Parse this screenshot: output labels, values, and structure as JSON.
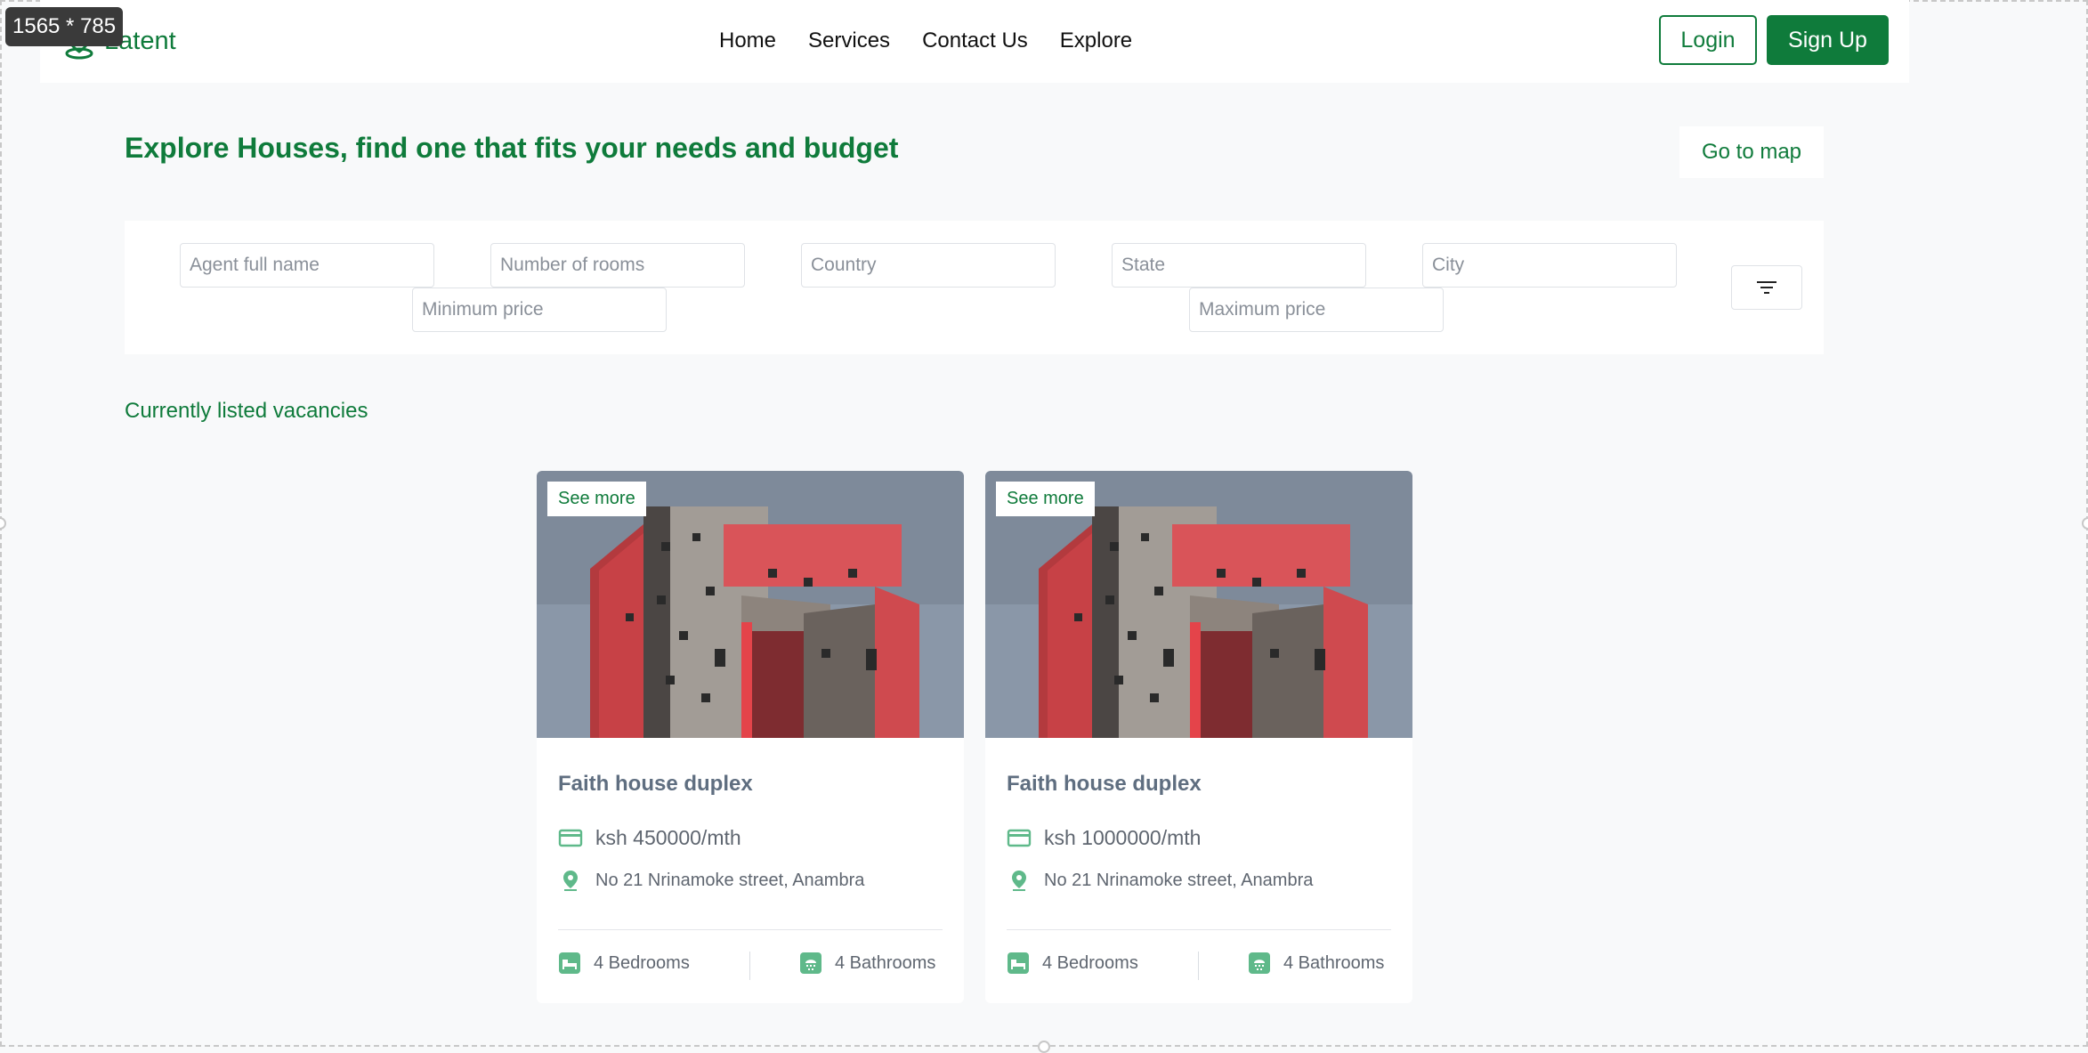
{
  "canvas_badge": "1565 * 785",
  "brand": {
    "name": "Latent",
    "logo_icon": "location-pin-logo-icon"
  },
  "nav": {
    "links": [
      "Home",
      "Services",
      "Contact Us",
      "Explore"
    ],
    "login_label": "Login",
    "signup_label": "Sign Up"
  },
  "heading": "Explore Houses, find one that fits your needs and budget",
  "map_button": "Go to map",
  "filters": {
    "agent": "Agent full name",
    "rooms": "Number of rooms",
    "country": "Country",
    "state": "State",
    "city": "City",
    "min_price": "Minimum price",
    "max_price": "Maximum price",
    "filter_icon": "filter-lines-icon"
  },
  "section_label": "Currently listed vacancies",
  "listings": [
    {
      "see_more": "See more",
      "title": "Faith house duplex",
      "price": "ksh 450000/mth",
      "address": "No 21 Nrinamoke street, Anambra",
      "bedrooms": "4 Bedrooms",
      "bathrooms": "4 Bathrooms"
    },
    {
      "see_more": "See more",
      "title": "Faith house duplex",
      "price": "ksh 1000000/mth",
      "address": "No 21 Nrinamoke street, Anambra",
      "bedrooms": "4 Bedrooms",
      "bathrooms": "4 Bathrooms"
    }
  ],
  "colors": {
    "brand_green": "#0f7b3b",
    "icon_green": "#5fb98a",
    "background": "#f8f9fa"
  }
}
